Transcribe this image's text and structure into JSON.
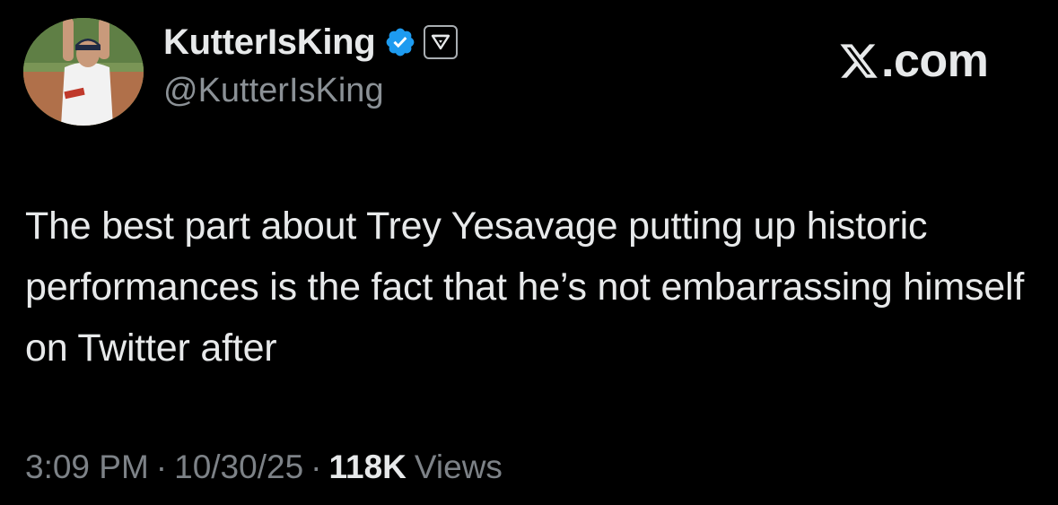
{
  "author": {
    "display_name": "KutterIsKing",
    "handle": "@KutterIsKing",
    "verified": true,
    "avatar_icon": "avatar-photo-baseball-player",
    "affiliate_icon": "affiliate-badge-icon"
  },
  "brand": {
    "label": ".com",
    "logo_icon": "x-logo-icon"
  },
  "tweet": {
    "text": "The best part about Trey Yesavage putting up historic performances is the fact that he’s not embarrassing himself on Twitter after"
  },
  "meta": {
    "time": "3:09 PM",
    "separator": "·",
    "date": "10/30/25",
    "views_count": "118K",
    "views_label": "Views"
  },
  "colors": {
    "background": "#000000",
    "text_primary": "#e7e9ea",
    "text_secondary": "#7d8287",
    "verified_blue": "#1d9bf0"
  }
}
